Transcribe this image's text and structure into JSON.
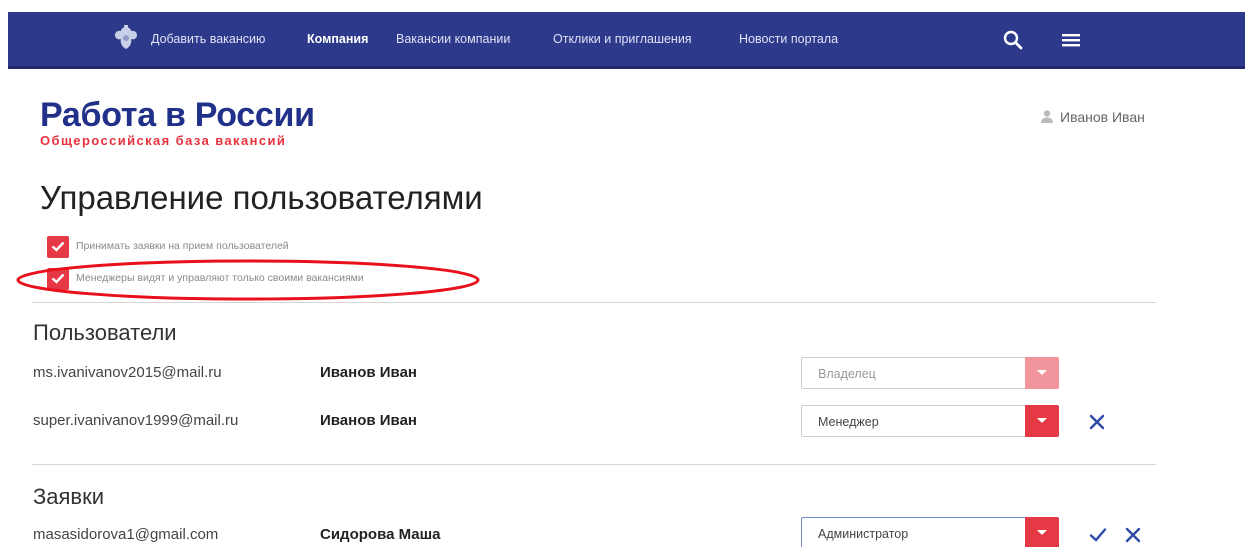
{
  "nav": {
    "items": [
      {
        "label": "Добавить вакансию",
        "active": false
      },
      {
        "label": "Компания",
        "active": true
      },
      {
        "label": "Вакансии компании",
        "active": false
      },
      {
        "label": "Отклики и приглашения",
        "active": false
      },
      {
        "label": "Новости портала",
        "active": false
      }
    ],
    "icons": [
      "emblem-icon",
      "search-icon",
      "hamburger-menu-icon"
    ]
  },
  "header": {
    "logo_title": "Работа в России",
    "logo_subtitle": "Общероссийская база вакансий",
    "user_name": "Иванов Иван",
    "user_icon": "user-icon"
  },
  "page": {
    "title": "Управление пользователями"
  },
  "settings": [
    {
      "label": "Принимать заявки на прием пользователей",
      "checked": true
    },
    {
      "label": "Менеджеры видят и управляют только своими вакансиями",
      "checked": true,
      "highlighted": true
    }
  ],
  "users_section": {
    "title": "Пользователи",
    "rows": [
      {
        "email": "ms.ivanivanov2015@mail.ru",
        "name": "Иванов Иван",
        "role": "Владелец",
        "disabled": true,
        "actions": []
      },
      {
        "email": "super.ivanivanov1999@mail.ru",
        "name": "Иванов Иван",
        "role": "Менеджер",
        "disabled": false,
        "actions": [
          "remove-icon"
        ]
      }
    ]
  },
  "requests_section": {
    "title": "Заявки",
    "rows": [
      {
        "email": "masasidorova1@gmail.com",
        "name": "Сидорова Маша",
        "role": "Администратор",
        "disabled": false,
        "actions": [
          "approve-icon",
          "reject-icon"
        ]
      }
    ]
  },
  "colors": {
    "nav_bg": "#2d3a8c",
    "logo_blue": "#21318a",
    "accent_red": "#e63946",
    "icon_blue": "#2d4aa8"
  }
}
